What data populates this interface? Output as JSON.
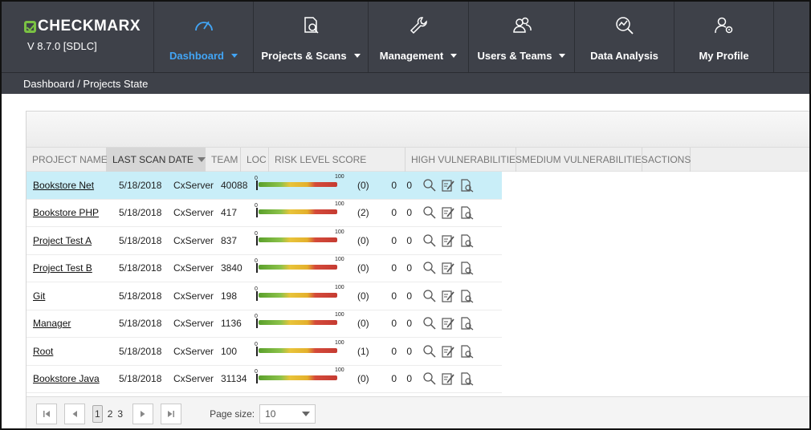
{
  "app": {
    "logo_text": "CHECKMARX",
    "version": "V 8.7.0  [SDLC]"
  },
  "nav": {
    "items": [
      {
        "label": "Dashboard",
        "icon": "gauge-icon",
        "active": true,
        "dropdown": true
      },
      {
        "label": "Projects & Scans",
        "icon": "document-search-icon",
        "active": false,
        "dropdown": true
      },
      {
        "label": "Management",
        "icon": "wrench-icon",
        "active": false,
        "dropdown": true
      },
      {
        "label": "Users & Teams",
        "icon": "users-icon",
        "active": false,
        "dropdown": true
      },
      {
        "label": "Data Analysis",
        "icon": "chart-search-icon",
        "active": false,
        "dropdown": false
      },
      {
        "label": "My Profile",
        "icon": "user-gear-icon",
        "active": false,
        "dropdown": false
      }
    ]
  },
  "breadcrumb": "Dashboard / Projects State",
  "table": {
    "columns": [
      "PROJECT NAME",
      "LAST SCAN DATE",
      "TEAM",
      "LOC",
      "RISK LEVEL SCORE",
      "HIGH VULNERABILITIES",
      "MEDIUM VULNERABILITIES",
      "ACTIONS"
    ],
    "sorted_column": "LAST SCAN DATE",
    "risk_min_label": "0",
    "risk_max_label": "100",
    "rows": [
      {
        "name": "Bookstore Net",
        "date": "5/18/2018",
        "team": "CxServer",
        "loc": "40088",
        "risk_count": "(0)",
        "high": "0",
        "medium": "0",
        "selected": true
      },
      {
        "name": "Bookstore PHP",
        "date": "5/18/2018",
        "team": "CxServer",
        "loc": "417",
        "risk_count": "(2)",
        "high": "0",
        "medium": "0",
        "selected": false
      },
      {
        "name": "Project Test A",
        "date": "5/18/2018",
        "team": "CxServer",
        "loc": "837",
        "risk_count": "(0)",
        "high": "0",
        "medium": "0",
        "selected": false
      },
      {
        "name": "Project Test B",
        "date": "5/18/2018",
        "team": "CxServer",
        "loc": "3840",
        "risk_count": "(0)",
        "high": "0",
        "medium": "0",
        "selected": false
      },
      {
        "name": "Git",
        "date": "5/18/2018",
        "team": "CxServer",
        "loc": "198",
        "risk_count": "(0)",
        "high": "0",
        "medium": "0",
        "selected": false
      },
      {
        "name": "Manager",
        "date": "5/18/2018",
        "team": "CxServer",
        "loc": "1136",
        "risk_count": "(0)",
        "high": "0",
        "medium": "0",
        "selected": false
      },
      {
        "name": "Root",
        "date": "5/18/2018",
        "team": "CxServer",
        "loc": "100",
        "risk_count": "(1)",
        "high": "0",
        "medium": "0",
        "selected": false
      },
      {
        "name": "Bookstore Java",
        "date": "5/18/2018",
        "team": "CxServer",
        "loc": "31134",
        "risk_count": "(0)",
        "high": "0",
        "medium": "0",
        "selected": false
      }
    ],
    "row_actions": [
      "view-scan-icon",
      "edit-project-icon",
      "scan-details-icon"
    ]
  },
  "pager": {
    "pages": [
      "1",
      "2",
      "3"
    ],
    "current_page": "1",
    "page_size_label": "Page size:",
    "page_size_value": "10"
  },
  "colors": {
    "nav_bg": "#3e4149",
    "active_nav": "#42a5f5",
    "selected_row": "#c9eef8",
    "logo_accent": "#7ac143"
  }
}
